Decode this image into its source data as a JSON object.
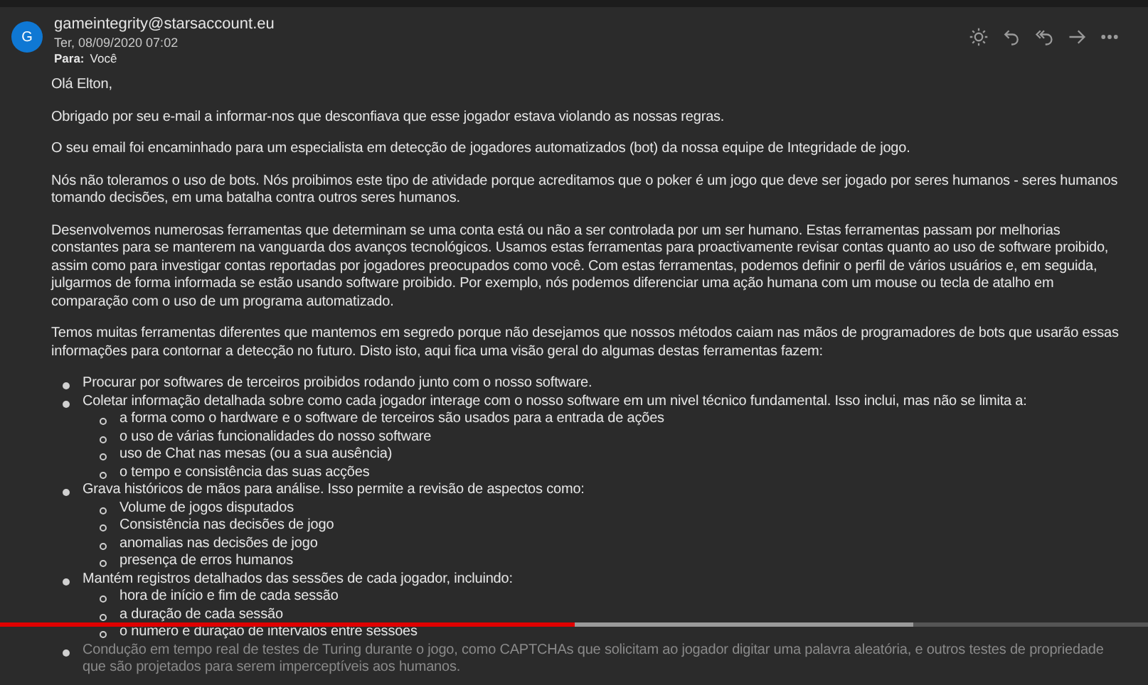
{
  "header": {
    "avatar_letter": "G",
    "sender": "gameintegrity@starsaccount.eu",
    "date": "Ter, 08/09/2020 07:02",
    "to_label": "Para:",
    "to": "Você"
  },
  "toolbar": [
    {
      "kind": "sun"
    },
    {
      "kind": "reply"
    },
    {
      "kind": "reply_all"
    },
    {
      "kind": "forward"
    },
    {
      "kind": "more"
    }
  ],
  "body": {
    "greeting": "Olá Elton,",
    "paragraphs": [
      "Obrigado por seu e-mail a informar-nos que desconfiava que esse jogador estava violando as nossas regras.",
      "O seu email foi encaminhado para um especialista em detecção de jogadores automatizados (bot) da nossa equipe de Integridade de jogo.",
      "Nós não toleramos o uso de bots. Nós proibimos este tipo de atividade porque acreditamos que o poker é um jogo que deve ser jogado por seres humanos - seres humanos tomando decisões, em uma batalha contra outros seres humanos.",
      "Desenvolvemos numerosas ferramentas que determinam se uma conta está ou não a ser controlada por um ser humano. Estas ferramentas passam por melhorias constantes para se manterem na vanguarda dos avanços tecnológicos. Usamos estas ferramentas para proactivamente revisar contas quanto ao uso de software proibido, assim como para investigar contas reportadas por jogadores preocupados como você. Com estas ferramentas, podemos definir o perfil de vários usuários e, em seguida, julgarmos de forma informada se estão usando software proibido. Por exemplo, nós podemos diferenciar uma ação humana com um mouse ou tecla de atalho em comparação com o uso de um programa automatizado.",
      "Temos muitas ferramentas diferentes que mantemos em segredo porque não desejamos que nossos métodos caiam nas mãos de programadores de bots que usarão essas informações para contornar a detecção no futuro. Disto isto, aqui fica uma visão geral do algumas destas ferramentas fazem:"
    ],
    "list": [
      {
        "text": "Procurar por softwares de terceiros proibidos rodando junto com o nosso software."
      },
      {
        "text": "Coletar informação detalhada sobre como cada jogador interage com o nosso software em um nivel técnico fundamental. Isso inclui, mas não se limita a:",
        "children": [
          {
            "text": "a forma como o hardware e o software de terceiros são usados para a entrada de ações"
          },
          {
            "text": "o uso de várias funcionalidades do nosso software"
          },
          {
            "text": "uso de Chat nas mesas (ou a sua ausência)"
          },
          {
            "text": "o tempo e consistência das suas acções"
          }
        ]
      },
      {
        "text": "Grava históricos de mãos para análise. Isso permite a revisão de aspectos como:",
        "children": [
          {
            "text": "Volume de jogos disputados"
          },
          {
            "text": "Consistência nas decisões de jogo"
          },
          {
            "text": "anomalias nas decisões de jogo"
          },
          {
            "text": "presença de erros humanos"
          }
        ]
      },
      {
        "text": "Mantém registros detalhados das sessões de cada jogador, incluindo:",
        "children": [
          {
            "text": "hora de início e fim de cada sessão"
          },
          {
            "text": "a duração de cada sessão"
          },
          {
            "text": "o número e duração de intervalos entre sessões"
          }
        ]
      },
      {
        "text": "Condução em tempo real de testes de Turing durante o jogo, como CAPTCHAs que solicitam ao jogador digitar uma palavra aleatória, e outros testes de propriedade que são projetados para serem imperceptíveis aos humanos."
      }
    ]
  },
  "video_bar": {
    "played": {
      "level": 0.5
    },
    "buffered": {
      "level": 0.795
    }
  }
}
